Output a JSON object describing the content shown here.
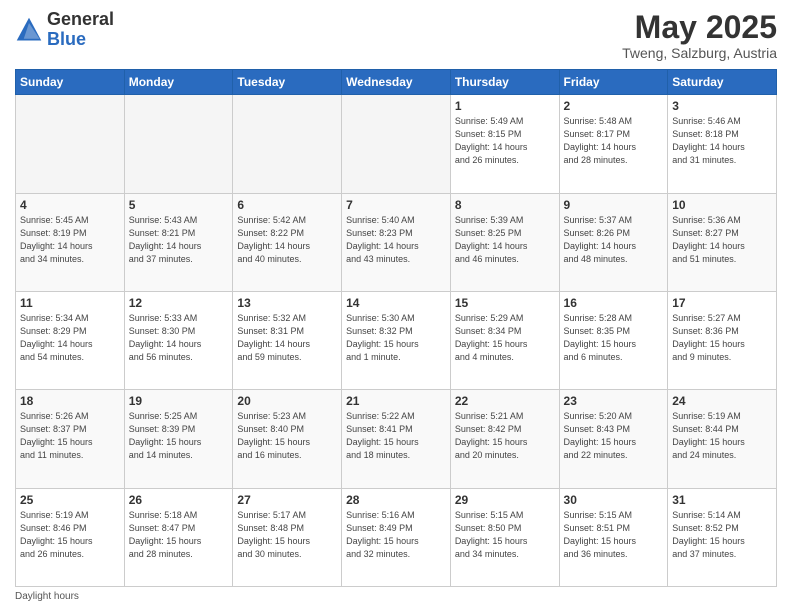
{
  "header": {
    "logo_general": "General",
    "logo_blue": "Blue",
    "month_title": "May 2025",
    "location": "Tweng, Salzburg, Austria"
  },
  "calendar": {
    "days_of_week": [
      "Sunday",
      "Monday",
      "Tuesday",
      "Wednesday",
      "Thursday",
      "Friday",
      "Saturday"
    ],
    "weeks": [
      [
        {
          "day": "",
          "info": ""
        },
        {
          "day": "",
          "info": ""
        },
        {
          "day": "",
          "info": ""
        },
        {
          "day": "",
          "info": ""
        },
        {
          "day": "1",
          "info": "Sunrise: 5:49 AM\nSunset: 8:15 PM\nDaylight: 14 hours\nand 26 minutes."
        },
        {
          "day": "2",
          "info": "Sunrise: 5:48 AM\nSunset: 8:17 PM\nDaylight: 14 hours\nand 28 minutes."
        },
        {
          "day": "3",
          "info": "Sunrise: 5:46 AM\nSunset: 8:18 PM\nDaylight: 14 hours\nand 31 minutes."
        }
      ],
      [
        {
          "day": "4",
          "info": "Sunrise: 5:45 AM\nSunset: 8:19 PM\nDaylight: 14 hours\nand 34 minutes."
        },
        {
          "day": "5",
          "info": "Sunrise: 5:43 AM\nSunset: 8:21 PM\nDaylight: 14 hours\nand 37 minutes."
        },
        {
          "day": "6",
          "info": "Sunrise: 5:42 AM\nSunset: 8:22 PM\nDaylight: 14 hours\nand 40 minutes."
        },
        {
          "day": "7",
          "info": "Sunrise: 5:40 AM\nSunset: 8:23 PM\nDaylight: 14 hours\nand 43 minutes."
        },
        {
          "day": "8",
          "info": "Sunrise: 5:39 AM\nSunset: 8:25 PM\nDaylight: 14 hours\nand 46 minutes."
        },
        {
          "day": "9",
          "info": "Sunrise: 5:37 AM\nSunset: 8:26 PM\nDaylight: 14 hours\nand 48 minutes."
        },
        {
          "day": "10",
          "info": "Sunrise: 5:36 AM\nSunset: 8:27 PM\nDaylight: 14 hours\nand 51 minutes."
        }
      ],
      [
        {
          "day": "11",
          "info": "Sunrise: 5:34 AM\nSunset: 8:29 PM\nDaylight: 14 hours\nand 54 minutes."
        },
        {
          "day": "12",
          "info": "Sunrise: 5:33 AM\nSunset: 8:30 PM\nDaylight: 14 hours\nand 56 minutes."
        },
        {
          "day": "13",
          "info": "Sunrise: 5:32 AM\nSunset: 8:31 PM\nDaylight: 14 hours\nand 59 minutes."
        },
        {
          "day": "14",
          "info": "Sunrise: 5:30 AM\nSunset: 8:32 PM\nDaylight: 15 hours\nand 1 minute."
        },
        {
          "day": "15",
          "info": "Sunrise: 5:29 AM\nSunset: 8:34 PM\nDaylight: 15 hours\nand 4 minutes."
        },
        {
          "day": "16",
          "info": "Sunrise: 5:28 AM\nSunset: 8:35 PM\nDaylight: 15 hours\nand 6 minutes."
        },
        {
          "day": "17",
          "info": "Sunrise: 5:27 AM\nSunset: 8:36 PM\nDaylight: 15 hours\nand 9 minutes."
        }
      ],
      [
        {
          "day": "18",
          "info": "Sunrise: 5:26 AM\nSunset: 8:37 PM\nDaylight: 15 hours\nand 11 minutes."
        },
        {
          "day": "19",
          "info": "Sunrise: 5:25 AM\nSunset: 8:39 PM\nDaylight: 15 hours\nand 14 minutes."
        },
        {
          "day": "20",
          "info": "Sunrise: 5:23 AM\nSunset: 8:40 PM\nDaylight: 15 hours\nand 16 minutes."
        },
        {
          "day": "21",
          "info": "Sunrise: 5:22 AM\nSunset: 8:41 PM\nDaylight: 15 hours\nand 18 minutes."
        },
        {
          "day": "22",
          "info": "Sunrise: 5:21 AM\nSunset: 8:42 PM\nDaylight: 15 hours\nand 20 minutes."
        },
        {
          "day": "23",
          "info": "Sunrise: 5:20 AM\nSunset: 8:43 PM\nDaylight: 15 hours\nand 22 minutes."
        },
        {
          "day": "24",
          "info": "Sunrise: 5:19 AM\nSunset: 8:44 PM\nDaylight: 15 hours\nand 24 minutes."
        }
      ],
      [
        {
          "day": "25",
          "info": "Sunrise: 5:19 AM\nSunset: 8:46 PM\nDaylight: 15 hours\nand 26 minutes."
        },
        {
          "day": "26",
          "info": "Sunrise: 5:18 AM\nSunset: 8:47 PM\nDaylight: 15 hours\nand 28 minutes."
        },
        {
          "day": "27",
          "info": "Sunrise: 5:17 AM\nSunset: 8:48 PM\nDaylight: 15 hours\nand 30 minutes."
        },
        {
          "day": "28",
          "info": "Sunrise: 5:16 AM\nSunset: 8:49 PM\nDaylight: 15 hours\nand 32 minutes."
        },
        {
          "day": "29",
          "info": "Sunrise: 5:15 AM\nSunset: 8:50 PM\nDaylight: 15 hours\nand 34 minutes."
        },
        {
          "day": "30",
          "info": "Sunrise: 5:15 AM\nSunset: 8:51 PM\nDaylight: 15 hours\nand 36 minutes."
        },
        {
          "day": "31",
          "info": "Sunrise: 5:14 AM\nSunset: 8:52 PM\nDaylight: 15 hours\nand 37 minutes."
        }
      ]
    ]
  },
  "footer": {
    "note": "Daylight hours"
  }
}
